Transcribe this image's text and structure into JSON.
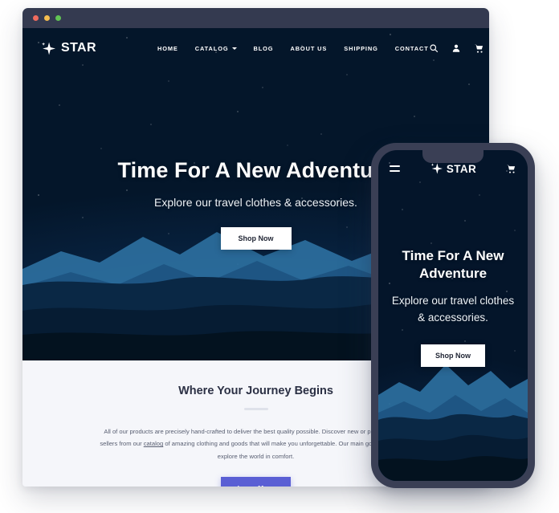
{
  "browser": {
    "window_controls": [
      "close",
      "minimize",
      "maximize"
    ]
  },
  "desktop": {
    "brand": {
      "name": "STAR",
      "icon": "sparkle-star-icon"
    },
    "menu": [
      {
        "label": "HOME",
        "has_dropdown": false
      },
      {
        "label": "CATALOG",
        "has_dropdown": true
      },
      {
        "label": "BLOG",
        "has_dropdown": false
      },
      {
        "label": "ABOUT US",
        "has_dropdown": false
      },
      {
        "label": "SHIPPING",
        "has_dropdown": false
      },
      {
        "label": "CONTACT",
        "has_dropdown": false
      }
    ],
    "actions": [
      {
        "icon": "search-icon"
      },
      {
        "icon": "user-account-icon"
      },
      {
        "icon": "shopping-cart-icon"
      }
    ],
    "hero": {
      "title": "Time For A New Adventure",
      "subtitle": "Explore our travel clothes & accessories.",
      "cta": "Shop Now"
    },
    "section": {
      "title": "Where Your Journey Begins",
      "body_part1": "All of our products are precisely hand-crafted to deliver the best quality possible. Discover new or purchase best-sellers from our ",
      "body_link": "catalog",
      "body_part2": " of amazing clothing and goods that will make you unforgettable. Our main goal to make you explore the world in comfort.",
      "cta": "Learn More"
    }
  },
  "phone": {
    "brand": {
      "name": "STAR",
      "icon": "sparkle-star-icon"
    },
    "menu_icon": "hamburger-menu-icon",
    "cart_icon": "shopping-cart-icon",
    "hero": {
      "title": "Time For A New Adventure",
      "subtitle": "Explore our travel clothes & accessories.",
      "cta": "Shop Now"
    }
  },
  "colors": {
    "accent": "#5a5fd4",
    "titlebar": "#343a50",
    "phone_frame": "#3a3f55",
    "section_bg": "#f5f6fa",
    "dot_red": "#ef6b5e",
    "dot_yellow": "#f4bd4f",
    "dot_green": "#61c454"
  }
}
